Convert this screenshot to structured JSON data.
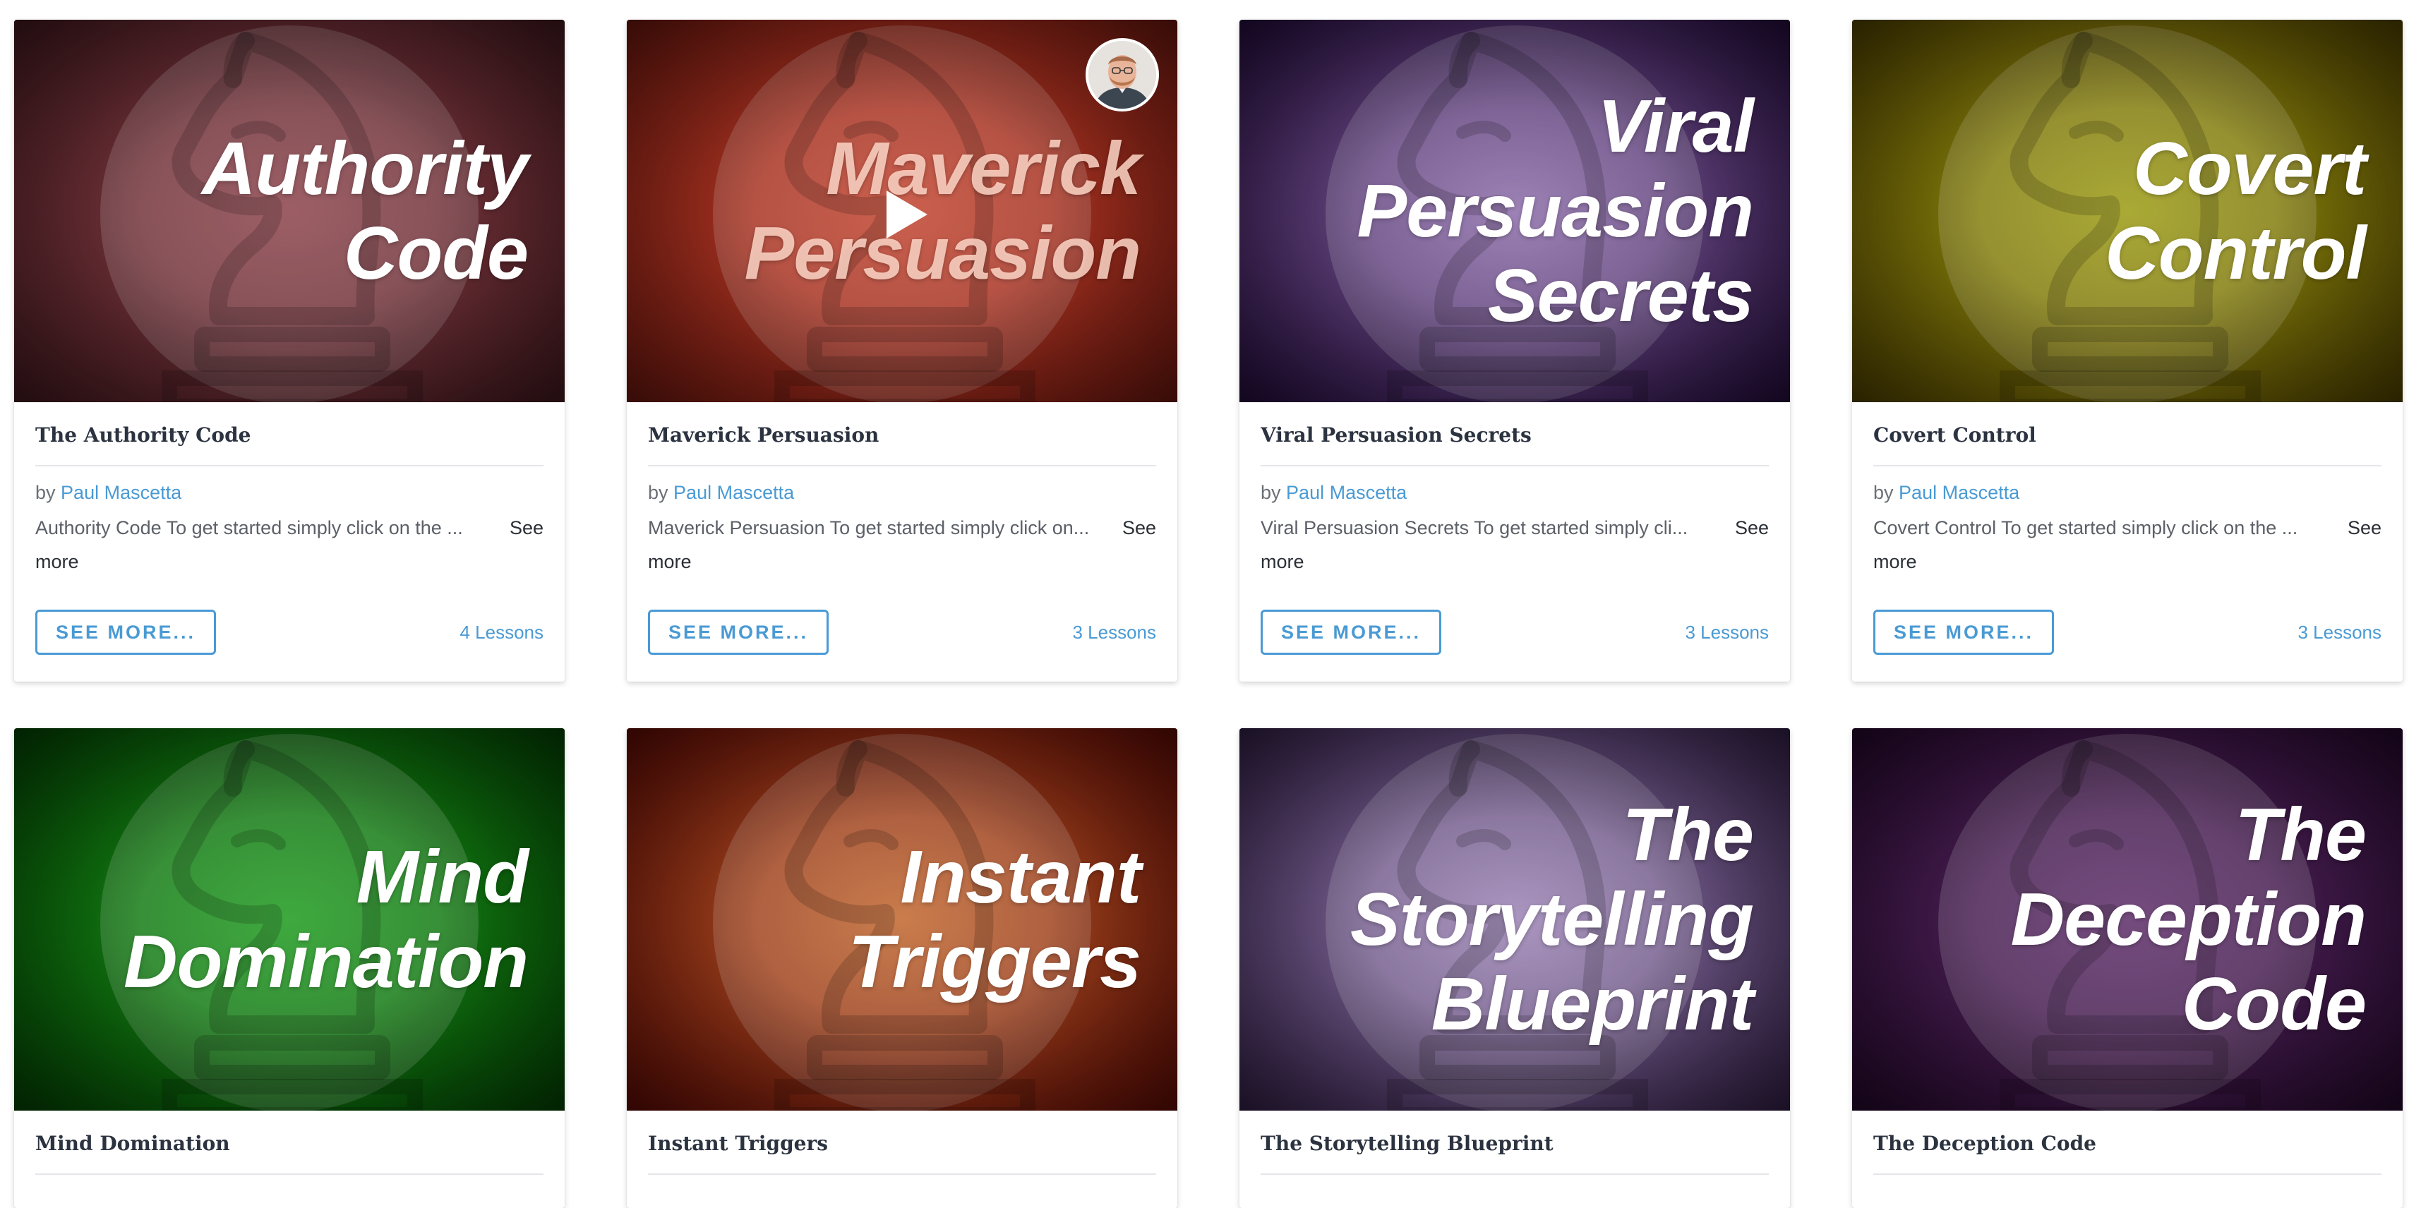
{
  "theme": {
    "accent": "#4a9ad4",
    "title_text": "#2c3340"
  },
  "courses": [
    {
      "thumbnail_title": [
        "Authority",
        "Code"
      ],
      "bg_inner": "#8a4048",
      "bg_outer": "#4a1c22",
      "title": "The Authority Code",
      "by": "by",
      "author": "Paul Mascetta",
      "description": "Authority Code To get started simply click on the ...",
      "see_more_link": "See",
      "see_more_link_2": "more",
      "button": "SEE MORE...",
      "lessons": "4 Lessons"
    },
    {
      "thumbnail_title": [
        "Maverick",
        "Persuasion"
      ],
      "bg_inner": "#c2412c",
      "bg_outer": "#7a1a10",
      "title": "Maverick Persuasion",
      "by": "by",
      "author": "Paul Mascetta",
      "description": "Maverick Persuasion To get started simply click on...",
      "see_more_link": "See",
      "see_more_link_2": "more",
      "button": "SEE MORE...",
      "lessons": "3 Lessons",
      "has_video": true,
      "icons": [
        "play-icon",
        "instructor-avatar"
      ]
    },
    {
      "thumbnail_title": [
        "Viral",
        "Persuasion",
        "Secrets"
      ],
      "bg_inner": "#8a6aa8",
      "bg_outer": "#2a0e44",
      "title": "Viral Persuasion Secrets",
      "by": "by",
      "author": "Paul Mascetta",
      "description": "Viral Persuasion Secrets To get started simply cli...",
      "see_more_link": "See",
      "see_more_link_2": "more",
      "button": "SEE MORE...",
      "lessons": "3 Lessons"
    },
    {
      "thumbnail_title": [
        "Covert",
        "Control"
      ],
      "bg_inner": "#9a9a10",
      "bg_outer": "#5a4a00",
      "title": "Covert Control",
      "by": "by",
      "author": "Paul Mascetta",
      "description": "Covert Control To get started simply click on the ...",
      "see_more_link": "See",
      "see_more_link_2": "more",
      "button": "SEE MORE...",
      "lessons": "3 Lessons"
    },
    {
      "thumbnail_title": [
        "Mind",
        "Domination"
      ],
      "bg_inner": "#1a9a1a",
      "bg_outer": "#044a04",
      "title": "Mind Domination"
    },
    {
      "thumbnail_title": [
        "Instant",
        "Triggers"
      ],
      "bg_inner": "#c0642a",
      "bg_outer": "#6a0c06",
      "title": "Instant Triggers"
    },
    {
      "thumbnail_title": [
        "The",
        "Storytelling",
        "Blueprint"
      ],
      "bg_inner": "#9a82b4",
      "bg_outer": "#3a2450",
      "title": "The Storytelling Blueprint"
    },
    {
      "thumbnail_title": [
        "The",
        "Deception",
        "Code"
      ],
      "bg_inner": "#5a2a66",
      "bg_outer": "#2a0a32",
      "title": "The Deception Code"
    }
  ]
}
